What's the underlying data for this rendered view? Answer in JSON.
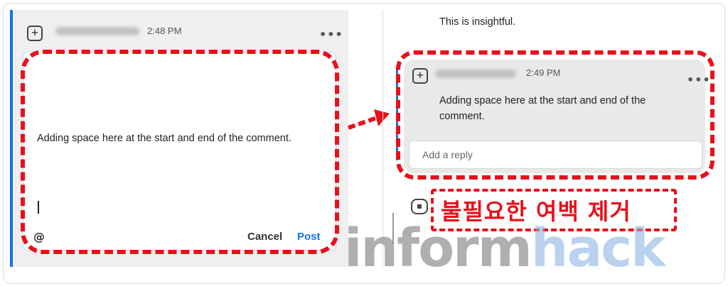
{
  "left": {
    "time": "2:48 PM",
    "more": "•••",
    "comment_text": "Adding space here at the start and end of the comment.",
    "mention_label": "@",
    "cancel_label": "Cancel",
    "post_label": "Post"
  },
  "right": {
    "previous_comment": "This is insightful.",
    "time": "2:49 PM",
    "more": "•••",
    "reply_text": "Adding space here at the start and end of the comment.",
    "reply_placeholder": "Add a reply"
  },
  "annotation": {
    "label": "불필요한 여백 제거"
  },
  "watermark": {
    "part1": "inform",
    "part2": "hack"
  },
  "colors": {
    "accent": "#1473e6",
    "annotation_red": "#e8101a"
  },
  "icons": [
    "comment-add-icon",
    "more-icon",
    "arrow-right-icon",
    "comment-icon"
  ]
}
